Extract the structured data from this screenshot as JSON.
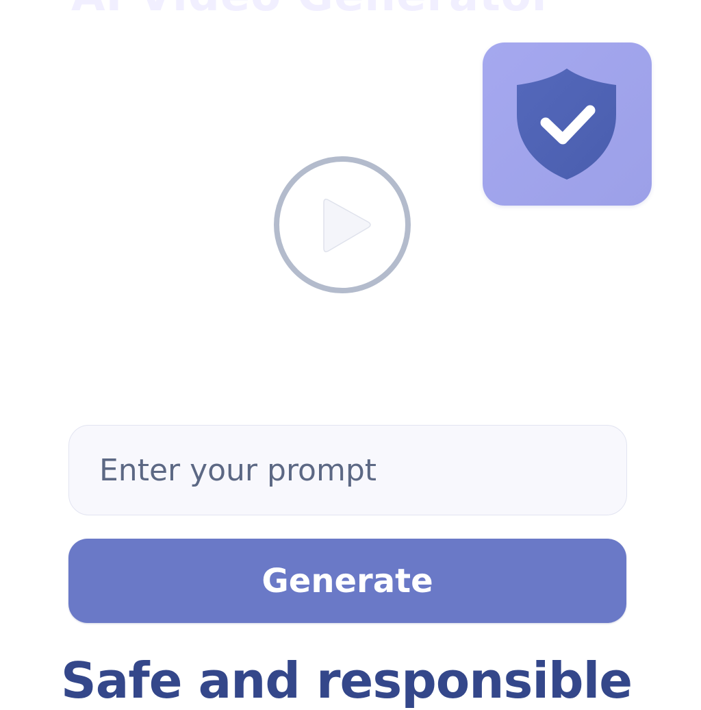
{
  "header": {
    "title": "AI Video Generator"
  },
  "badge": {
    "icon": "shield-check-icon",
    "colors": {
      "background": "#a3a6ee",
      "shield": "#4f64b5",
      "check": "#ffffff"
    }
  },
  "player": {
    "icon": "play-icon",
    "colors": {
      "ring": "#b5bccd",
      "triangle": "#f4f5fa"
    }
  },
  "prompt": {
    "placeholder": "Enter your prompt",
    "value": ""
  },
  "actions": {
    "generate_label": "Generate"
  },
  "tagline": {
    "text": "Safe and responsible"
  },
  "colors": {
    "accent": "#6a79c7",
    "heading": "#34478a",
    "input_background": "#f8f8fd"
  }
}
